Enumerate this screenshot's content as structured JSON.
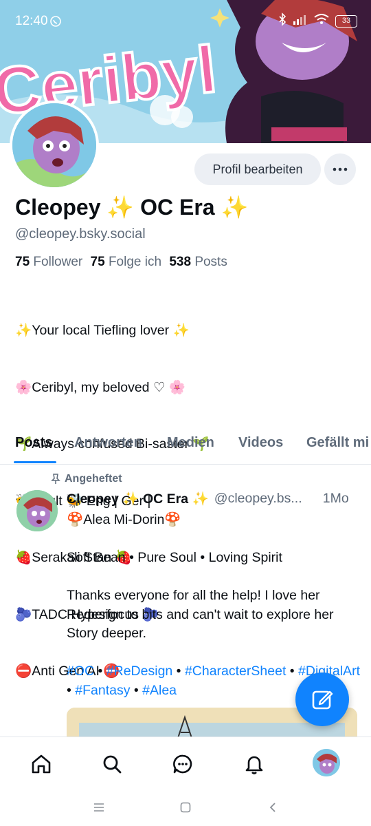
{
  "status_bar": {
    "time": "12:40",
    "battery": "33",
    "icons": [
      "whatsapp-icon",
      "bluetooth-icon",
      "signal-icon",
      "wifi-icon",
      "battery-icon"
    ]
  },
  "banner": {
    "text": "Ceribyl",
    "colors": {
      "sky": "#7fc8e6",
      "lettering": "#f06aa8"
    }
  },
  "profile": {
    "edit_button": "Profil bearbeiten",
    "display_name": "Cleopey ✨ OC Era ✨",
    "handle": "@cleopey.bsky.social",
    "stats": {
      "followers_count": "75",
      "followers_label": "Follower",
      "following_count": "75",
      "following_label": "Folge ich",
      "posts_count": "538",
      "posts_label": "Posts"
    },
    "bio": [
      "✨Your local Tiefling lover ✨",
      "🌸Ceribyl, my beloved ♡ 🌸",
      "🌱Always confused Bi-saster 🌱",
      "🐝Adult 🐝 Eng | Ger |",
      "🍓Serakali Stan 🍓",
      "🫐TADC Hyperfocus 🫐",
      "⛔Anti Gen AI ⛔"
    ]
  },
  "tabs": [
    {
      "label": "Posts",
      "active": true
    },
    {
      "label": "Antworten",
      "active": false
    },
    {
      "label": "Medien",
      "active": false
    },
    {
      "label": "Videos",
      "active": false
    },
    {
      "label": "Gefällt mi",
      "active": false
    }
  ],
  "post": {
    "pinned_label": "Angeheftet",
    "author": "Cleopey ✨ OC Era ✨",
    "handle": "@cleopey.bs...",
    "time": "1Mo",
    "line1": "🍄Alea Mi-Dorin🍄",
    "line2": "Soft Bean • Pure Soul • Loving Spirit",
    "line3": "Thanks everyone for all the help! I love her Redesign to bits and can't wait to explore her Story deeper.",
    "tags": [
      "#OC",
      "#ReDesign",
      "#CharacterSheet",
      "#DigitalArt",
      "#Fantasy",
      "#Alea"
    ],
    "separator": " • "
  },
  "bottom_nav": [
    "home-icon",
    "search-icon",
    "chat-icon",
    "bell-icon",
    "profile-avatar"
  ],
  "accent_color": "#1083fe"
}
